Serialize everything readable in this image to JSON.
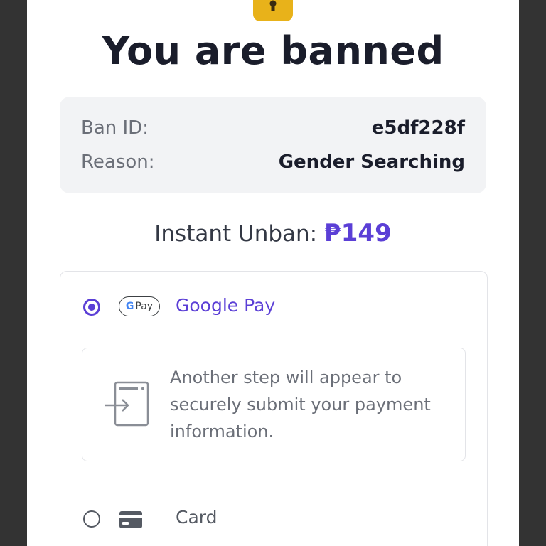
{
  "page": {
    "title": "You are banned"
  },
  "ban_info": {
    "id_label": "Ban ID:",
    "id_value": "e5df228f",
    "reason_label": "Reason:",
    "reason_value": "Gender Searching"
  },
  "unban": {
    "label": "Instant Unban:",
    "price": "₱149"
  },
  "payment": {
    "google_pay": {
      "label": "Google Pay",
      "badge_g": "G",
      "badge_text": "Pay",
      "selected": true,
      "note": "Another step will appear to securely submit your payment information."
    },
    "card": {
      "label": "Card",
      "selected": false
    }
  },
  "colors": {
    "accent": "#5b3fd6",
    "lock": "#e8b21a",
    "backdrop": "#333333"
  },
  "icons": {
    "lock": "lock-icon",
    "redirect": "redirect-icon",
    "card": "credit-card-icon"
  }
}
